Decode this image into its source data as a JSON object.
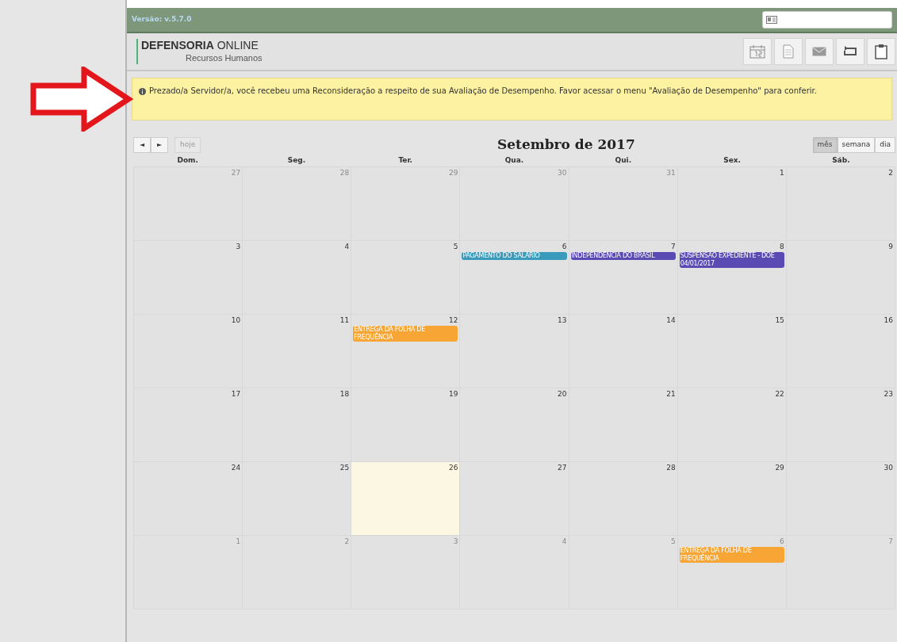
{
  "version": "Versão: v.5.7.0",
  "brand": {
    "bold": "DEFENSORIA",
    "light": "ONLINE",
    "subtitle": "Recursos Humanos"
  },
  "alert": "Prezado/a Servidor/a, você recebeu uma Reconsideração a respeito de sua Avaliação de Desempenho. Favor acessar o menu \"Avaliação de Desempenho\" para conferir.",
  "toolbar": {
    "prev": "◄",
    "next": "►",
    "today": "hoje",
    "title": "Setembro de 2017",
    "views": [
      {
        "label": "mês",
        "selected": true
      },
      {
        "label": "semana",
        "selected": false
      },
      {
        "label": "dia",
        "selected": false
      }
    ]
  },
  "weekdays": [
    "Dom.",
    "Seg.",
    "Ter.",
    "Qua.",
    "Qui.",
    "Sex.",
    "Sáb."
  ],
  "weeks": [
    [
      {
        "day": "27",
        "other_month": true,
        "today": false
      },
      {
        "day": "28",
        "other_month": true,
        "today": false
      },
      {
        "day": "29",
        "other_month": true,
        "today": false
      },
      {
        "day": "30",
        "other_month": true,
        "today": false
      },
      {
        "day": "31",
        "other_month": true,
        "today": false
      },
      {
        "day": "1",
        "other_month": false,
        "today": false
      },
      {
        "day": "2",
        "other_month": false,
        "today": false
      }
    ],
    [
      {
        "day": "3",
        "other_month": false,
        "today": false
      },
      {
        "day": "4",
        "other_month": false,
        "today": false
      },
      {
        "day": "5",
        "other_month": false,
        "today": false
      },
      {
        "day": "6",
        "other_month": false,
        "today": false,
        "events": [
          {
            "title": "PAGAMENTO DO SALÁRIO",
            "color": "#3a9bbd"
          }
        ]
      },
      {
        "day": "7",
        "other_month": false,
        "today": false,
        "events": [
          {
            "title": "INDEPENDÊNCIA DO BRASIL",
            "color": "#5a4ab3"
          }
        ]
      },
      {
        "day": "8",
        "other_month": false,
        "today": false,
        "events": [
          {
            "title": "SUSPENSÃO EXPEDIENTE - DOE 04/01/2017",
            "color": "#5a4ab3"
          }
        ]
      },
      {
        "day": "9",
        "other_month": false,
        "today": false
      }
    ],
    [
      {
        "day": "10",
        "other_month": false,
        "today": false
      },
      {
        "day": "11",
        "other_month": false,
        "today": false
      },
      {
        "day": "12",
        "other_month": false,
        "today": false,
        "events": [
          {
            "title": "ENTREGA DA FOLHA DE FREQUÊNCIA",
            "color": "#f7a535"
          }
        ]
      },
      {
        "day": "13",
        "other_month": false,
        "today": false
      },
      {
        "day": "14",
        "other_month": false,
        "today": false
      },
      {
        "day": "15",
        "other_month": false,
        "today": false
      },
      {
        "day": "16",
        "other_month": false,
        "today": false
      }
    ],
    [
      {
        "day": "17",
        "other_month": false,
        "today": false
      },
      {
        "day": "18",
        "other_month": false,
        "today": false
      },
      {
        "day": "19",
        "other_month": false,
        "today": false
      },
      {
        "day": "20",
        "other_month": false,
        "today": false
      },
      {
        "day": "21",
        "other_month": false,
        "today": false
      },
      {
        "day": "22",
        "other_month": false,
        "today": false
      },
      {
        "day": "23",
        "other_month": false,
        "today": false
      }
    ],
    [
      {
        "day": "24",
        "other_month": false,
        "today": false
      },
      {
        "day": "25",
        "other_month": false,
        "today": false
      },
      {
        "day": "26",
        "other_month": false,
        "today": true
      },
      {
        "day": "27",
        "other_month": false,
        "today": false
      },
      {
        "day": "28",
        "other_month": false,
        "today": false
      },
      {
        "day": "29",
        "other_month": false,
        "today": false
      },
      {
        "day": "30",
        "other_month": false,
        "today": false
      }
    ],
    [
      {
        "day": "1",
        "other_month": true,
        "today": false
      },
      {
        "day": "2",
        "other_month": true,
        "today": false
      },
      {
        "day": "3",
        "other_month": true,
        "today": false
      },
      {
        "day": "4",
        "other_month": true,
        "today": false
      },
      {
        "day": "5",
        "other_month": true,
        "today": false
      },
      {
        "day": "6",
        "other_month": true,
        "today": false,
        "events": [
          {
            "title": "ENTREGA DA FOLHA DE FREQUÊNCIA",
            "color": "#f7a535"
          }
        ]
      },
      {
        "day": "7",
        "other_month": true,
        "today": false
      }
    ]
  ]
}
